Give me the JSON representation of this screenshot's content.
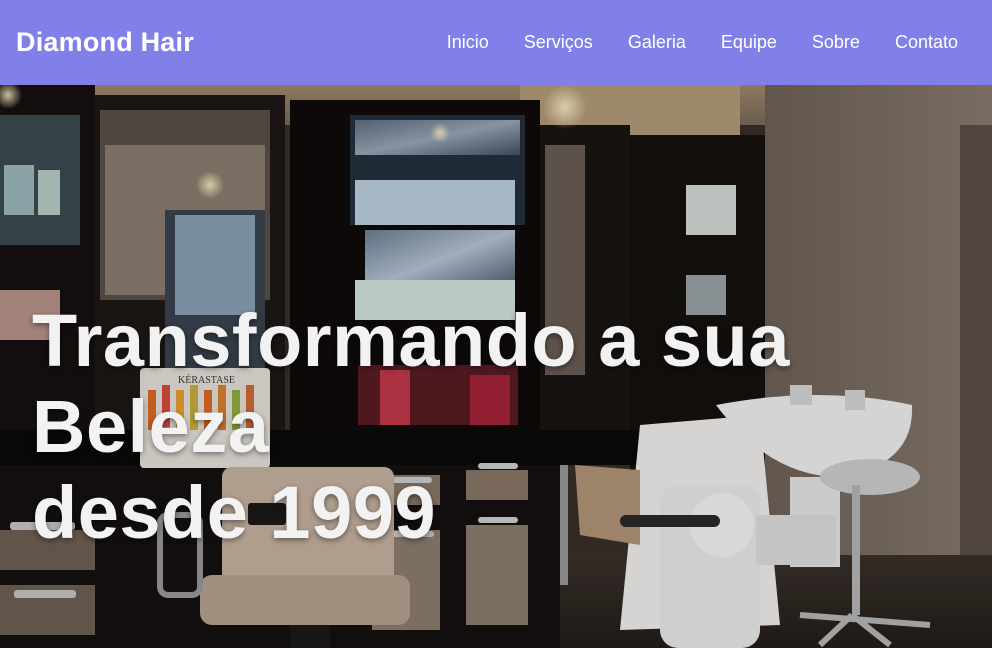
{
  "header": {
    "brand": "Diamond Hair",
    "nav": [
      {
        "label": "Inicio"
      },
      {
        "label": "Serviços"
      },
      {
        "label": "Galeria"
      },
      {
        "label": "Equipe"
      },
      {
        "label": "Sobre"
      },
      {
        "label": "Contato"
      }
    ],
    "background_color": "#8080e8"
  },
  "hero": {
    "headline_line1": "Transformando a sua Beleza",
    "headline_line2": "desde 1999",
    "image_subject": "salon interior with mirrors, shelves of hair products, styling chair and wash basin",
    "product_brand_sign": "KÉRASTASE"
  }
}
